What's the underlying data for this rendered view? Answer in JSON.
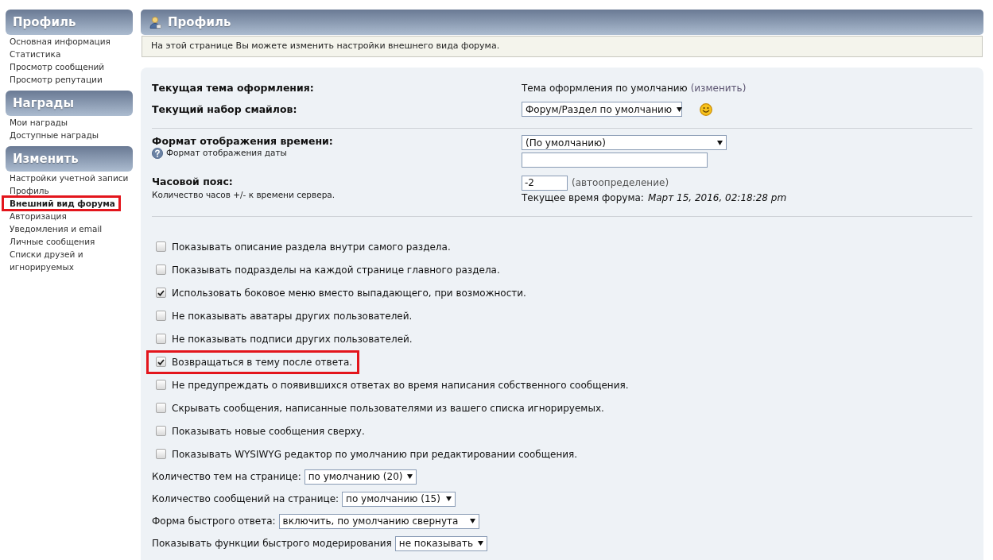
{
  "sidebar": {
    "sections": [
      {
        "title": "Профиль",
        "items": [
          {
            "label": "Основная информация",
            "selected": false,
            "highlighted": false
          },
          {
            "label": "Статистика",
            "selected": false,
            "highlighted": false
          },
          {
            "label": "Просмотр сообщений",
            "selected": false,
            "highlighted": false
          },
          {
            "label": "Просмотр репутации",
            "selected": false,
            "highlighted": false
          }
        ]
      },
      {
        "title": "Награды",
        "items": [
          {
            "label": "Мои награды",
            "selected": false,
            "highlighted": false
          },
          {
            "label": "Доступные награды",
            "selected": false,
            "highlighted": false
          }
        ]
      },
      {
        "title": "Изменить",
        "items": [
          {
            "label": "Настройки учетной записи",
            "selected": false,
            "highlighted": false
          },
          {
            "label": "Профиль",
            "selected": false,
            "highlighted": false
          },
          {
            "label": "Внешний вид форума",
            "selected": true,
            "highlighted": true
          },
          {
            "label": "Авторизация",
            "selected": false,
            "highlighted": false
          },
          {
            "label": "Уведомления и email",
            "selected": false,
            "highlighted": false
          },
          {
            "label": "Личные сообщения",
            "selected": false,
            "highlighted": false
          },
          {
            "label": "Списки друзей и игнорируемых",
            "selected": false,
            "highlighted": false
          }
        ]
      }
    ]
  },
  "page": {
    "title": "Профиль",
    "notice": "На этой странице Вы можете изменить настройки внешнего вида форума."
  },
  "form": {
    "theme": {
      "label": "Текущая тема оформления:",
      "value": "Тема оформления по умолчанию",
      "link": "(изменить)"
    },
    "smilies": {
      "label": "Текущий набор смайлов:",
      "value": "Форум/Раздел по умолчанию"
    },
    "time_format": {
      "label": "Формат отображения времени:",
      "help": "Формат отображения даты",
      "value": "(По умолчанию)"
    },
    "timezone": {
      "label": "Часовой пояс:",
      "description": "Количество часов +/- к времени сервера.",
      "value": "-2",
      "hint": "(автоопределение)",
      "current_time_label": "Текущее время форума:",
      "current_time": "Март 15, 2016, 02:18:28 pm"
    },
    "options": [
      {
        "label": "Показывать описание раздела внутри самого раздела.",
        "checked": false,
        "highlighted": false
      },
      {
        "label": "Показывать подразделы на каждой странице главного раздела.",
        "checked": false,
        "highlighted": false
      },
      {
        "label": "Использовать боковое меню вместо выпадающего, при возможности.",
        "checked": true,
        "highlighted": false
      },
      {
        "label": "Не показывать аватары других пользователей.",
        "checked": false,
        "highlighted": false
      },
      {
        "label": "Не показывать подписи других пользователей.",
        "checked": false,
        "highlighted": false
      },
      {
        "label": "Возвращаться в тему после ответа.",
        "checked": true,
        "highlighted": true
      },
      {
        "label": "Не предупреждать о появившихся ответах во время написания собственного сообщения.",
        "checked": false,
        "highlighted": false
      },
      {
        "label": "Скрывать сообщения, написанные пользователями из вашего списка игнорируемых.",
        "checked": false,
        "highlighted": false
      },
      {
        "label": "Показывать новые сообщения сверху.",
        "checked": false,
        "highlighted": false
      },
      {
        "label": "Показывать WYSIWYG редактор по умолчанию при редактировании сообщения.",
        "checked": false,
        "highlighted": false
      }
    ],
    "selects": [
      {
        "label": "Количество тем на странице:",
        "value": "по умолчанию (20)"
      },
      {
        "label": "Количество сообщений на странице:",
        "value": "по умолчанию (15)"
      },
      {
        "label": "Форма быстрого ответа:",
        "value": "включить, по умолчанию свернута"
      },
      {
        "label": "Показывать функции быстрого модерирования",
        "value": "не показывать"
      }
    ]
  }
}
